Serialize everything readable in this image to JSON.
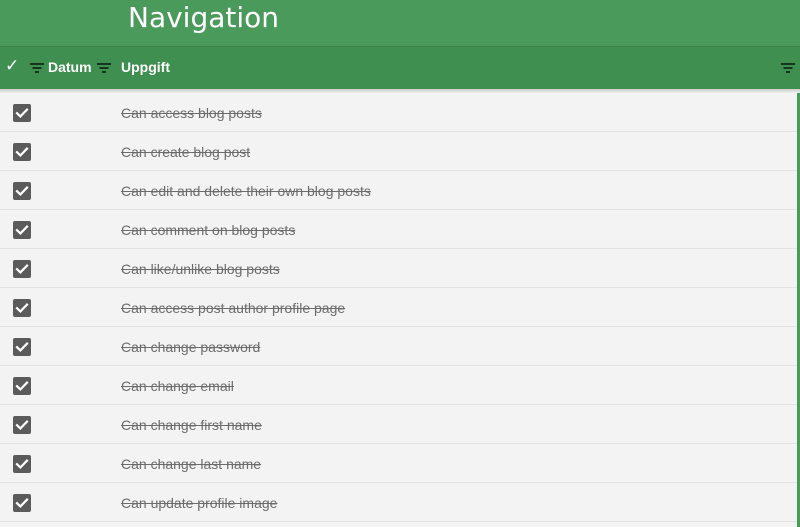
{
  "app": {
    "title": "Navigation"
  },
  "header": {
    "check_symbol": "✓",
    "columns": {
      "date": "Datum",
      "task": "Uppgift"
    }
  },
  "tasks": [
    {
      "text": "Can access blog posts",
      "done": true
    },
    {
      "text": "Can create blog post",
      "done": true
    },
    {
      "text": "Can edit and delete their own blog posts",
      "done": true
    },
    {
      "text": "Can comment on blog posts",
      "done": true
    },
    {
      "text": "Can like/unlike blog posts",
      "done": true
    },
    {
      "text": "Can access post author profile page",
      "done": true
    },
    {
      "text": "Can change password",
      "done": true
    },
    {
      "text": "Can change email",
      "done": true
    },
    {
      "text": "Can change first name",
      "done": true
    },
    {
      "text": "Can change last name",
      "done": true
    },
    {
      "text": "Can update profile image",
      "done": true
    }
  ],
  "colors": {
    "title_bar": "#4a9a5b",
    "header_bar": "#3f8f50",
    "checkbox": "#5b5b5b",
    "task_text": "#6c6c6c"
  },
  "icons": {
    "header_check": "check-icon",
    "column_filter": "filter-icon",
    "row_checkbox": "checkbox-checked-icon"
  }
}
